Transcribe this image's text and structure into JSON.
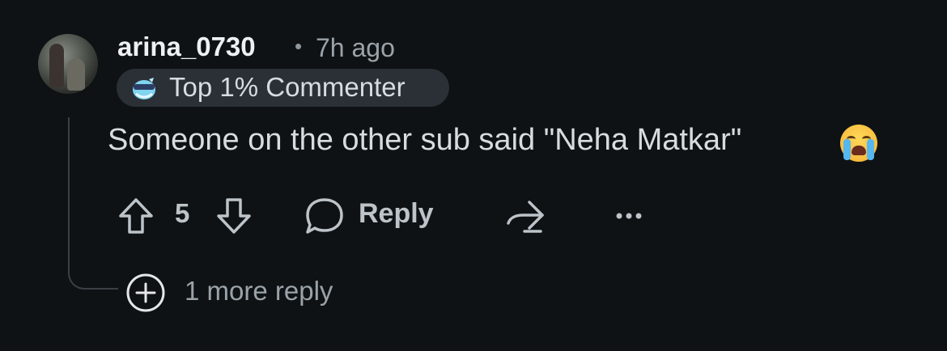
{
  "comment": {
    "username": "arina_0730",
    "separator": "•",
    "time_ago": "7h ago",
    "flair": "Top 1% Commenter",
    "text": "Someone on the other sub said \"Neha Matkar\""
  },
  "actions": {
    "vote_count": "5",
    "reply_label": "Reply"
  },
  "thread": {
    "more_replies_label": "1 more reply"
  },
  "colors": {
    "background": "#0f1214",
    "flair_bg": "#2a3035",
    "text_primary": "#d7dce0",
    "text_muted": "#9aa3aa"
  },
  "icons": [
    "avatar",
    "flair-sunglasses-icon",
    "crying-face-emoji",
    "upvote-icon",
    "downvote-icon",
    "comment-icon",
    "share-icon",
    "more-options-icon",
    "expand-plus-icon"
  ]
}
